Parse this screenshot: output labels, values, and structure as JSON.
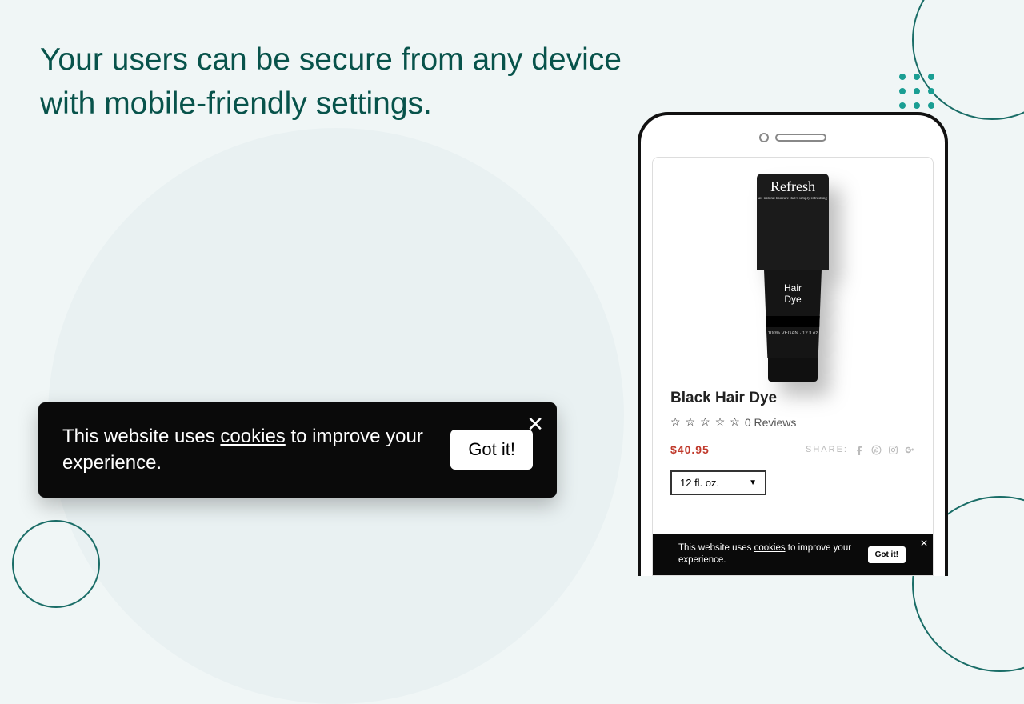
{
  "headline": {
    "line1": "Your users can be secure from any device",
    "line2": "with mobile-friendly settings."
  },
  "cookie_banner": {
    "prefix": "This website uses ",
    "link": "cookies",
    "suffix": " to improve your experience.",
    "button": "Got it!"
  },
  "phone": {
    "product": {
      "brand": "Refresh",
      "tagline": "all-natural haircare that's simply refreshing",
      "label_line1": "Hair",
      "label_line2": "Dye",
      "sub": "100% VEGAN · 12 fl oz",
      "title": "Black Hair Dye",
      "reviews_count": "0 Reviews",
      "price": "$40.95",
      "share_label": "SHARE:",
      "size_selected": "12 fl. oz."
    },
    "cookie_banner": {
      "prefix": "This website uses ",
      "link": "cookies",
      "suffix": " to improve your experience.",
      "button": "Got it!"
    }
  }
}
